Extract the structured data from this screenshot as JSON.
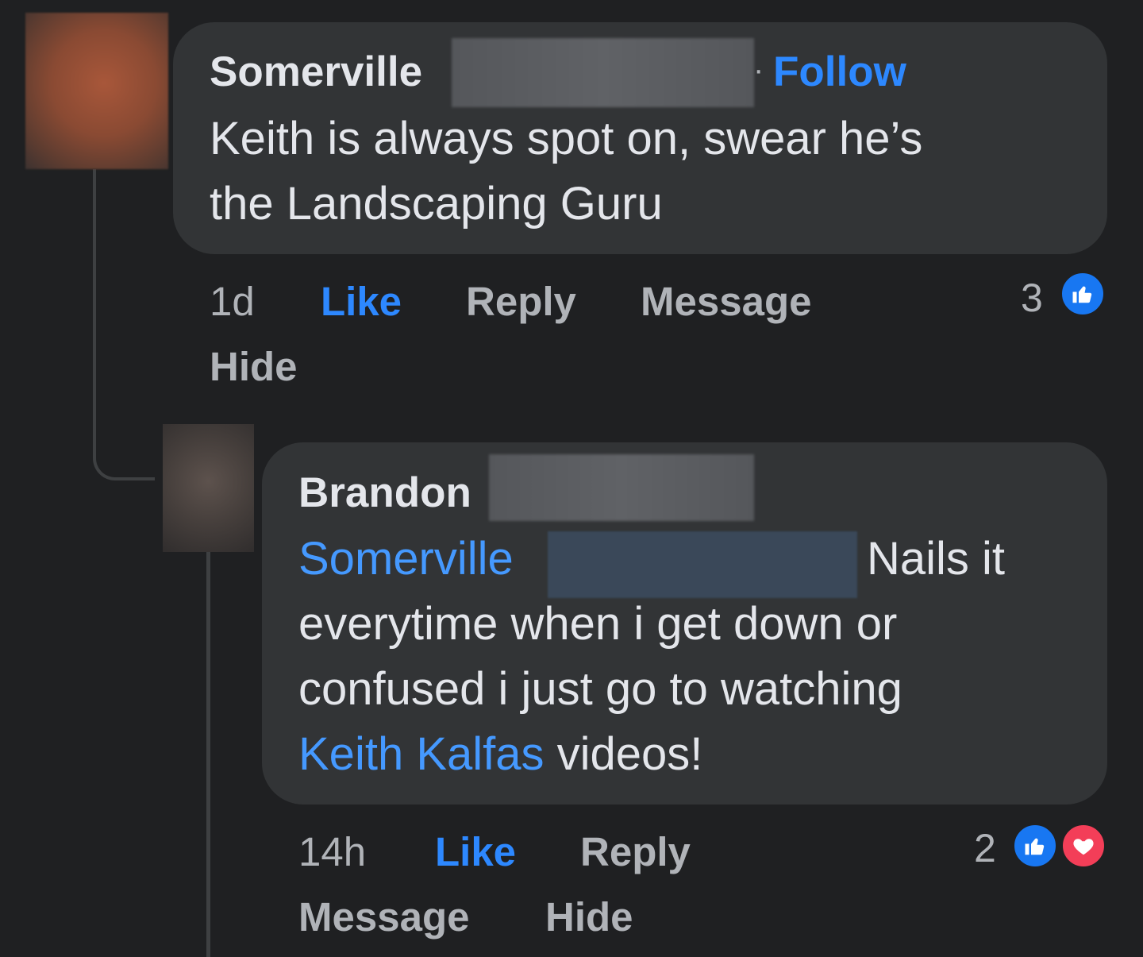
{
  "comment1": {
    "author": "Somerville",
    "separator": "·",
    "follow_label": "Follow",
    "text_line1": "Keith is always spot on, swear he’s",
    "text_line2": "the Landscaping Guru",
    "time": "1d",
    "like_label": "Like",
    "reply_label": "Reply",
    "message_label": "Message",
    "hide_label": "Hide",
    "reaction_count": "3",
    "reactions": [
      "like-icon"
    ]
  },
  "comment2": {
    "author": "Brandon",
    "mention": "Somerville",
    "text_after_mention": "Nails it",
    "text_line2": "everytime when i get down or",
    "text_line3": "confused i just go to watching",
    "link_text": "Keith Kalfas",
    "text_after_link": " videos!",
    "time": "14h",
    "like_label": "Like",
    "reply_label": "Reply",
    "message_label": "Message",
    "hide_label": "Hide",
    "reaction_count": "2",
    "reactions": [
      "like-icon",
      "love-icon"
    ]
  },
  "colors": {
    "background": "#1f2022",
    "bubble": "#323436",
    "link": "#4599ff",
    "action_active": "#2d88ff",
    "like_reaction": "#1877f2",
    "love_reaction": "#f33e58"
  }
}
